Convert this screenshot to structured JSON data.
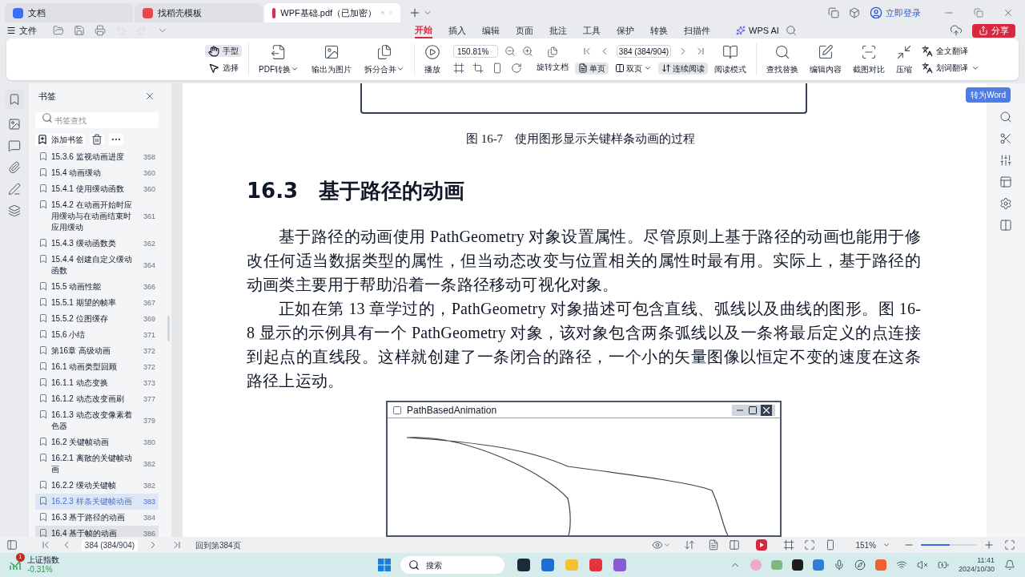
{
  "tabs": [
    {
      "label": "文档",
      "selected": false
    },
    {
      "label": "找稻壳模板",
      "selected": false
    },
    {
      "label": "WPF基础.pdf（已加密）",
      "selected": true
    }
  ],
  "menu": {
    "file": "文件",
    "ribbon_tabs": [
      {
        "label": "开始",
        "selected": true
      },
      {
        "label": "插入",
        "selected": false
      },
      {
        "label": "编辑",
        "selected": false
      },
      {
        "label": "页面",
        "selected": false
      },
      {
        "label": "批注",
        "selected": false
      },
      {
        "label": "工具",
        "selected": false
      },
      {
        "label": "保护",
        "selected": false
      },
      {
        "label": "转换",
        "selected": false
      },
      {
        "label": "扫描件",
        "selected": false
      }
    ],
    "ai": "WPS AI",
    "login": "立即登录",
    "share": "分享"
  },
  "toolbar": {
    "hand": {
      "label": "手型",
      "selected": true
    },
    "select": "选择",
    "convert": [
      {
        "label": "PDF转换",
        "dropdown": true
      },
      {
        "label": "输出为图片",
        "dropdown": false
      },
      {
        "label": "拆分合并",
        "dropdown": true
      }
    ],
    "play": "播放",
    "zoom": "150.81%",
    "page": "384 (384/904)",
    "rotate": "旋转文档",
    "single": {
      "label": "单页",
      "selected": true
    },
    "double": {
      "label": "双页",
      "selected": false
    },
    "continuous": {
      "label": "连续阅读",
      "selected": true
    },
    "read_mode": "阅读模式",
    "tools": [
      "查找替换",
      "编辑内容",
      "截图对比",
      "压缩"
    ],
    "translate_full": "全文翻译",
    "translate_word": "划词翻译"
  },
  "bookmarks": {
    "title": "书签",
    "placeholder": "书签查找",
    "add": "添加书签",
    "items": [
      {
        "label": "15.3.6 监视动画进度",
        "page": "358",
        "selected": false,
        "hovered": false
      },
      {
        "label": "15.4 动画缓动",
        "page": "360",
        "selected": false,
        "hovered": false
      },
      {
        "label": "15.4.1 使用缓动函数",
        "page": "360",
        "selected": false,
        "hovered": false
      },
      {
        "label": "15.4.2 在动画开始时应用缓动与在动画结束时应用缓动",
        "page": "361",
        "selected": false,
        "hovered": false
      },
      {
        "label": "15.4.3 缓动函数类",
        "page": "362",
        "selected": false,
        "hovered": false
      },
      {
        "label": "15.4.4 创建自定义缓动函数",
        "page": "364",
        "selected": false,
        "hovered": false
      },
      {
        "label": "15.5 动画性能",
        "page": "366",
        "selected": false,
        "hovered": false
      },
      {
        "label": "15.5.1 期望的帧率",
        "page": "367",
        "selected": false,
        "hovered": false
      },
      {
        "label": "15.5.2 位图缓存",
        "page": "369",
        "selected": false,
        "hovered": false
      },
      {
        "label": "15.6 小结",
        "page": "371",
        "selected": false,
        "hovered": false
      },
      {
        "label": "第16章 高级动画",
        "page": "372",
        "selected": false,
        "hovered": false
      },
      {
        "label": "16.1 动画类型回顾",
        "page": "372",
        "selected": false,
        "hovered": false
      },
      {
        "label": "16.1.1 动态变换",
        "page": "373",
        "selected": false,
        "hovered": false
      },
      {
        "label": "16.1.2 动态改变画刷",
        "page": "377",
        "selected": false,
        "hovered": false
      },
      {
        "label": "16.1.3 动态改变像素着色器",
        "page": "379",
        "selected": false,
        "hovered": false
      },
      {
        "label": "16.2 关键帧动画",
        "page": "380",
        "selected": false,
        "hovered": false
      },
      {
        "label": "16.2.1 离散的关键帧动画",
        "page": "382",
        "selected": false,
        "hovered": false
      },
      {
        "label": "16.2.2 缓动关键帧",
        "page": "382",
        "selected": false,
        "hovered": false
      },
      {
        "label": "16.2.3 样条关键帧动画",
        "page": "383",
        "selected": true,
        "hovered": false
      },
      {
        "label": "16.3 基于路径的动画",
        "page": "384",
        "selected": false,
        "hovered": false
      },
      {
        "label": "16.4 基于帧的动画",
        "page": "386",
        "selected": false,
        "hovered": true
      }
    ]
  },
  "to_word": "转为Word",
  "document": {
    "caption": "图 16-7　使用图形显示关键样条动画的过程",
    "section_number": "16.3",
    "section_title": "基于路径的动画",
    "paragraphs": [
      "基于路径的动画使用 PathGeometry 对象设置属性。尽管原则上基于路径的动画也能用于修改任何适当数据类型的属性，但当动态改变与位置相关的属性时最有用。实际上，基于路径的动画类主要用于帮助沿着一条路径移动可视化对象。",
      "正如在第 13 章学过的，PathGeometry 对象描述可包含直线、弧线以及曲线的图形。图 16-8 显示的示例具有一个 PathGeometry 对象，该对象包含两条弧线以及一条将最后定义的点连接到起点的直线段。这样就创建了一条闭合的路径，一个小的矢量图像以恒定不变的速度在这条路径上运动。"
    ],
    "figure_window_title": "PathBasedAnimation"
  },
  "status_bar": {
    "page": "384 (384/904)",
    "back": "回到第384页",
    "zoom": "151%",
    "level": 0.52
  },
  "taskbar": {
    "widget_badge": "1",
    "widget_title": "上证指数",
    "widget_value": "-0.31%",
    "search": "搜索",
    "time": "11:41",
    "date": "2024/10/30"
  }
}
